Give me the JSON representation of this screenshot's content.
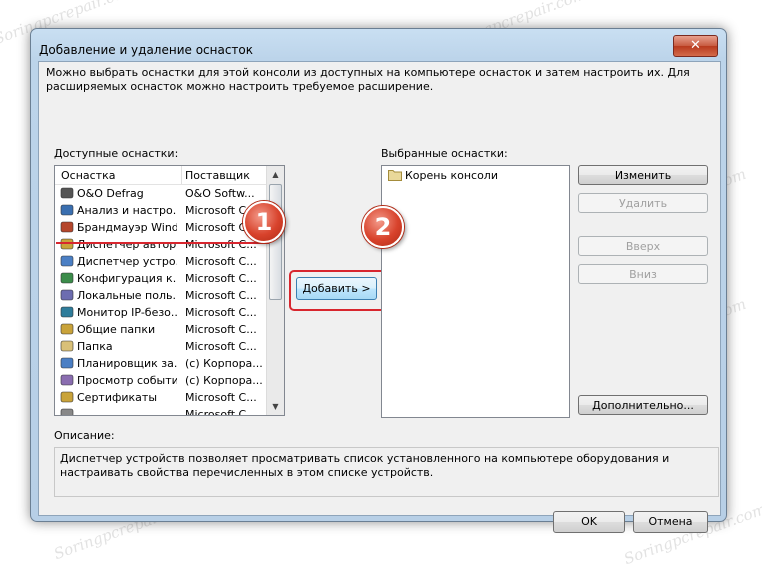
{
  "window": {
    "title": "Добавление и удаление оснасток",
    "close_label": "✕",
    "intro": "Можно выбрать оснастки для этой консоли из доступных на компьютере оснасток и затем настроить их. Для расширяемых оснасток можно настроить требуемое расширение."
  },
  "available": {
    "label": "Доступные оснастки:",
    "col_name": "Оснастка",
    "col_vendor": "Поставщик",
    "rows": [
      {
        "name": "O&O Defrag",
        "vendor": "O&O Softw...",
        "icon": "defrag-icon"
      },
      {
        "name": "Анализ и настро...",
        "vendor": "Microsoft C...",
        "icon": "security-config-icon"
      },
      {
        "name": "Брандмауэр Wind...",
        "vendor": "Microsoft C...",
        "icon": "firewall-icon"
      },
      {
        "name": "Диспетчер автор...",
        "vendor": "Microsoft C...",
        "icon": "authorization-icon"
      },
      {
        "name": "Диспетчер устро...",
        "vendor": "Microsoft C...",
        "icon": "device-manager-icon"
      },
      {
        "name": "Конфигурация к...",
        "vendor": "Microsoft C...",
        "icon": "client-config-icon"
      },
      {
        "name": "Локальные поль...",
        "vendor": "Microsoft C...",
        "icon": "users-icon"
      },
      {
        "name": "Монитор IP-безо...",
        "vendor": "Microsoft C...",
        "icon": "ip-monitor-icon"
      },
      {
        "name": "Общие папки",
        "vendor": "Microsoft C...",
        "icon": "shared-folders-icon"
      },
      {
        "name": "Папка",
        "vendor": "Microsoft C...",
        "icon": "folder-icon"
      },
      {
        "name": "Планировщик за...",
        "vendor": "(c) Корпора...",
        "icon": "scheduler-icon"
      },
      {
        "name": "Просмотр событий",
        "vendor": "(c) Корпора...",
        "icon": "event-viewer-icon"
      },
      {
        "name": "Сертификаты",
        "vendor": "Microsoft C...",
        "icon": "certificates-icon"
      },
      {
        "name": "",
        "vendor": "Microsoft C...",
        "icon": "unknown-icon"
      }
    ]
  },
  "selected": {
    "label": "Выбранные оснастки:",
    "items": [
      {
        "name": "Корень консоли",
        "icon": "folder-icon"
      }
    ]
  },
  "buttons": {
    "add": "Добавить >",
    "edit_ext": "Изменить расширения...",
    "remove": "Удалить",
    "up": "Вверх",
    "down": "Вниз",
    "advanced": "Дополнительно...",
    "ok": "OK",
    "cancel": "Отмена"
  },
  "description": {
    "label": "Описание:",
    "text": "Диспетчер устройств позволяет просматривать список установленного на компьютере оборудования и настраивать свойства перечисленных в этом списке устройств."
  },
  "annotations": {
    "badge1": "1",
    "badge2": "2"
  },
  "watermark": "Soringpcrepair.com",
  "colors": {
    "highlight": "#d8262e",
    "selected_button": "#a7d9f5"
  }
}
